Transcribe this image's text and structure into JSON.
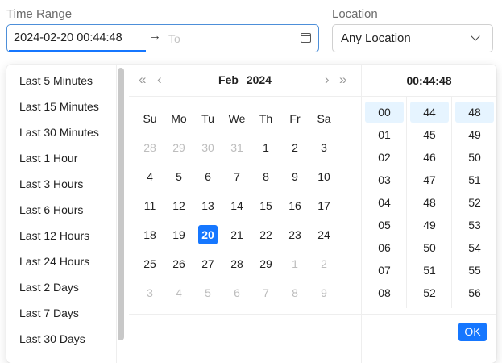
{
  "labels": {
    "time_range": "Time Range",
    "location": "Location"
  },
  "range": {
    "start": "2024-02-20 00:44:48",
    "arrow": "→",
    "end_placeholder": "To"
  },
  "location": {
    "value": "Any Location"
  },
  "presets": [
    "Last 5 Minutes",
    "Last 15 Minutes",
    "Last 30 Minutes",
    "Last 1 Hour",
    "Last 3 Hours",
    "Last 6 Hours",
    "Last 12 Hours",
    "Last 24 Hours",
    "Last 2 Days",
    "Last 7 Days",
    "Last 30 Days"
  ],
  "calendar": {
    "nav": {
      "prev_year": "«",
      "prev_month": "‹",
      "next_month": "›",
      "next_year": "»"
    },
    "month": "Feb",
    "year": "2024",
    "weekdays": [
      "Su",
      "Mo",
      "Tu",
      "We",
      "Th",
      "Fr",
      "Sa"
    ],
    "weeks": [
      [
        "28",
        "29",
        "30",
        "31",
        "1",
        "2",
        "3"
      ],
      [
        "4",
        "5",
        "6",
        "7",
        "8",
        "9",
        "10"
      ],
      [
        "11",
        "12",
        "13",
        "14",
        "15",
        "16",
        "17"
      ],
      [
        "18",
        "19",
        "20",
        "21",
        "22",
        "23",
        "24"
      ],
      [
        "25",
        "26",
        "27",
        "28",
        "29",
        "1",
        "2"
      ],
      [
        "3",
        "4",
        "5",
        "6",
        "7",
        "8",
        "9"
      ]
    ],
    "other_month": [
      [
        true,
        true,
        true,
        true,
        false,
        false,
        false
      ],
      [
        false,
        false,
        false,
        false,
        false,
        false,
        false
      ],
      [
        false,
        false,
        false,
        false,
        false,
        false,
        false
      ],
      [
        false,
        false,
        false,
        false,
        false,
        false,
        false
      ],
      [
        false,
        false,
        false,
        false,
        false,
        true,
        true
      ],
      [
        true,
        true,
        true,
        true,
        true,
        true,
        true
      ]
    ],
    "selected_day": "20"
  },
  "time": {
    "header": "00:44:48",
    "hours": [
      "00",
      "01",
      "02",
      "03",
      "04",
      "05",
      "06",
      "07",
      "08"
    ],
    "minutes": [
      "44",
      "45",
      "46",
      "47",
      "48",
      "49",
      "50",
      "51",
      "52"
    ],
    "seconds": [
      "48",
      "49",
      "50",
      "51",
      "52",
      "53",
      "54",
      "55",
      "56"
    ],
    "selected": {
      "hour": "00",
      "minute": "44",
      "second": "48"
    }
  },
  "ok_label": "OK",
  "colors": {
    "accent": "#1677ff",
    "selected_cell_bg": "#e6f4ff",
    "muted_text": "#bdbdbd"
  },
  "icons": {
    "calendar": "calendar-icon",
    "location_dropdown": "chevron-down-icon"
  }
}
